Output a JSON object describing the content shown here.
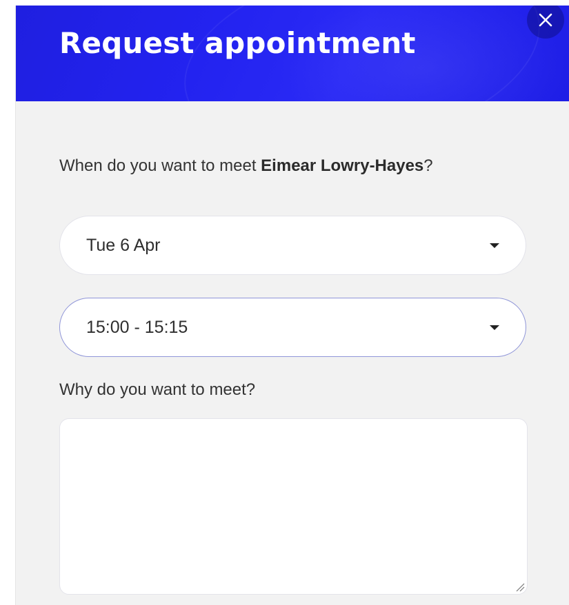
{
  "modal": {
    "title": "Request appointment",
    "close_icon": "close-icon",
    "colors": {
      "header_blue": "#2323f0",
      "body_bg": "#f2f2f2"
    }
  },
  "form": {
    "question_prefix": "When do you want to meet ",
    "person_name": "Eimear Lowry-Hayes",
    "question_suffix": "?",
    "date_select": {
      "value": "Tue 6 Apr",
      "icon": "caret-down-icon"
    },
    "time_select": {
      "value": "15:00 - 15:15",
      "icon": "caret-down-icon"
    },
    "reason_label": "Why do you want to meet?",
    "reason_value": "",
    "resize_icon": "resize-grip-icon"
  }
}
